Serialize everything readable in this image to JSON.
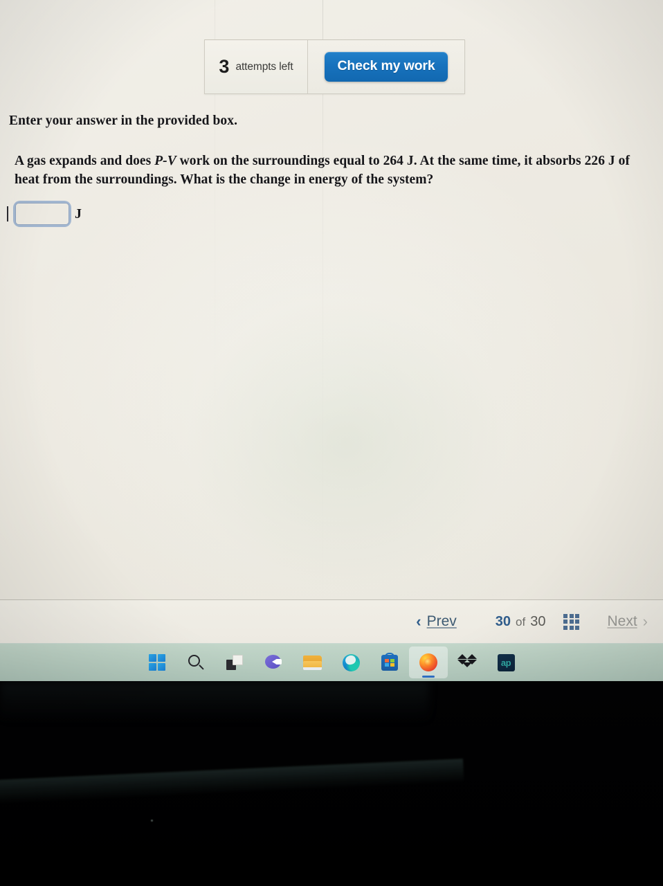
{
  "header": {
    "attempts_count": "3",
    "attempts_label": "attempts left",
    "check_button_label": "Check my work"
  },
  "question": {
    "instruction": "Enter your answer in the provided box.",
    "text_part1": "A gas expands and does ",
    "text_italic": "P-V",
    "text_part2": " work on the surroundings equal to 264 J. At the same time, it absorbs 226 J of heat from the surroundings. What is the change in energy of the system?"
  },
  "answer": {
    "value": "",
    "placeholder": "",
    "unit": "J"
  },
  "navigation": {
    "prev_label": "Prev",
    "next_label": "Next",
    "prev_chevron": "‹",
    "next_chevron": "›",
    "current_page": "30",
    "of_label": "of",
    "total_pages": "30",
    "grid_icon_name": "all-questions-grid"
  },
  "taskbar": {
    "items": [
      {
        "name": "start-button",
        "label": "Start",
        "active": false
      },
      {
        "name": "search-icon",
        "label": "Search",
        "active": false
      },
      {
        "name": "task-view-icon",
        "label": "Task View",
        "active": false
      },
      {
        "name": "chat-icon",
        "label": "Chat",
        "active": false
      },
      {
        "name": "file-explorer-icon",
        "label": "File Explorer",
        "active": false
      },
      {
        "name": "edge-icon",
        "label": "Microsoft Edge",
        "active": false
      },
      {
        "name": "microsoft-store-icon",
        "label": "Microsoft Store",
        "active": false
      },
      {
        "name": "firefox-icon",
        "label": "Firefox",
        "active": true
      },
      {
        "name": "dropbox-icon",
        "label": "Dropbox",
        "active": false
      },
      {
        "name": "app-icon",
        "label": "App",
        "active": false
      }
    ]
  },
  "colors": {
    "accent_blue": "#1772bd",
    "link_blue": "#3d5a72",
    "page_background": "#eeebe3",
    "taskbar_background": "#b7cdc0",
    "disabled_gray": "#9a9a96"
  }
}
